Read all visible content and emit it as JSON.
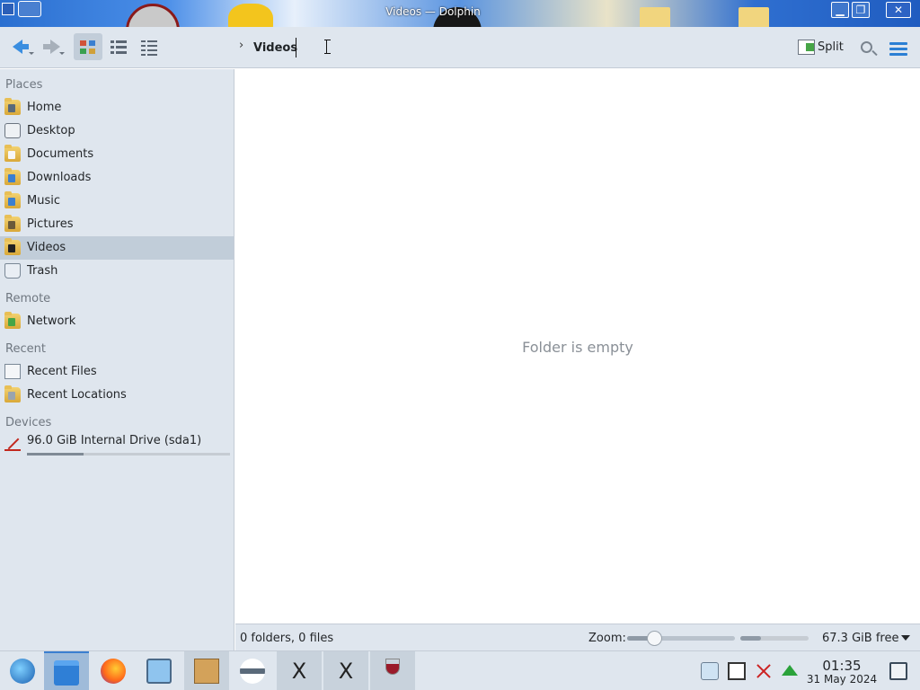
{
  "window": {
    "title": "Videos — Dolphin",
    "controls": [
      "minimize",
      "maximize",
      "close"
    ]
  },
  "toolbar": {
    "back_icon": "go-previous-icon",
    "forward_icon": "go-next-icon",
    "view_modes": [
      "icons",
      "compact",
      "details"
    ],
    "active_view_mode": "icons",
    "breadcrumb": {
      "separator": "›",
      "current": "Videos"
    },
    "split_label": "Split",
    "search_icon": "search-icon",
    "menu_icon": "hamburger-menu-icon"
  },
  "sidebar": {
    "sections": {
      "places": "Places",
      "remote": "Remote",
      "recent": "Recent",
      "devices": "Devices"
    },
    "places": [
      {
        "label": "Home",
        "icon": "home-folder-icon"
      },
      {
        "label": "Desktop",
        "icon": "desktop-icon"
      },
      {
        "label": "Documents",
        "icon": "documents-folder-icon"
      },
      {
        "label": "Downloads",
        "icon": "downloads-folder-icon"
      },
      {
        "label": "Music",
        "icon": "music-folder-icon"
      },
      {
        "label": "Pictures",
        "icon": "pictures-folder-icon"
      },
      {
        "label": "Videos",
        "icon": "videos-folder-icon",
        "selected": true
      },
      {
        "label": "Trash",
        "icon": "trash-icon"
      }
    ],
    "remote": [
      {
        "label": "Network",
        "icon": "network-folder-icon"
      }
    ],
    "recent": [
      {
        "label": "Recent Files",
        "icon": "recent-files-icon"
      },
      {
        "label": "Recent Locations",
        "icon": "recent-locations-icon"
      }
    ],
    "devices": [
      {
        "label": "96.0 GiB Internal Drive (sda1)",
        "icon": "hard-drive-icon",
        "usage_fraction": 0.28
      }
    ]
  },
  "content": {
    "empty_message": "Folder is empty"
  },
  "statusbar": {
    "summary": "0 folders, 0 files",
    "zoom_label": "Zoom:",
    "zoom_fraction": 0.25,
    "free_space": "67.3 GiB free",
    "free_space_used_fraction": 0.3
  },
  "taskbar": {
    "apps": [
      {
        "name": "start-menu-icon",
        "state": "normal"
      },
      {
        "name": "dolphin-file-manager-icon",
        "state": "active"
      },
      {
        "name": "firefox-icon",
        "state": "normal"
      },
      {
        "name": "system-settings-icon",
        "state": "normal"
      },
      {
        "name": "package-archive-icon",
        "state": "open"
      },
      {
        "name": "aircraft-app-icon",
        "state": "normal"
      },
      {
        "name": "x-app-icon",
        "state": "open"
      },
      {
        "name": "x-app-icon",
        "state": "open"
      },
      {
        "name": "wine-glass-icon",
        "state": "open"
      }
    ],
    "tray_icons": [
      "clipboard-icon",
      "notes-icon",
      "network-disconnected-icon",
      "updates-arrow-icon",
      "show-desktop-icon"
    ],
    "clock_time": "01:35",
    "clock_date": "31 May 2024"
  },
  "colors": {
    "accent": "#3b7fd0",
    "selection": "#c1cdd9",
    "chrome": "#dfe6ee",
    "folder": "#e3b64a"
  }
}
